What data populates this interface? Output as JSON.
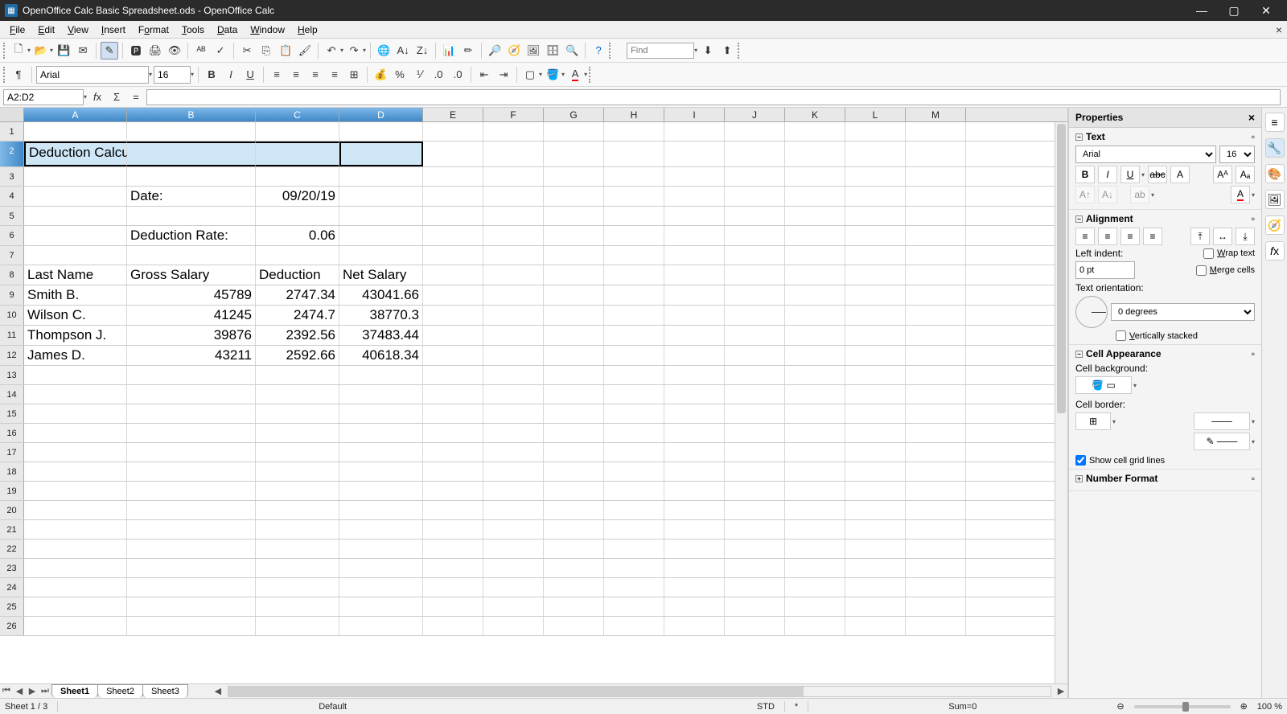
{
  "title": "OpenOffice Calc Basic Spreadsheet.ods - OpenOffice Calc",
  "menus": [
    "File",
    "Edit",
    "View",
    "Insert",
    "Format",
    "Tools",
    "Data",
    "Window",
    "Help"
  ],
  "find_placeholder": "Find",
  "font_name": "Arial",
  "font_size": "16",
  "cell_ref": "A2:D2",
  "columns": [
    "A",
    "B",
    "C",
    "D",
    "E",
    "F",
    "G",
    "H",
    "I",
    "J",
    "K",
    "L",
    "M"
  ],
  "cells": {
    "A2": "Deduction Calculations for Employees",
    "B4": "Date:",
    "C4": "09/20/19",
    "B6": "Deduction Rate:",
    "C6": "0.06",
    "A8": "Last Name",
    "B8": "Gross Salary",
    "C8": "Deduction",
    "D8": "Net Salary",
    "A9": "Smith B.",
    "B9": "45789",
    "C9": "2747.34",
    "D9": "43041.66",
    "A10": "Wilson C.",
    "B10": "41245",
    "C10": "2474.7",
    "D10": "38770.3",
    "A11": "Thompson J.",
    "B11": "39876",
    "C11": "2392.56",
    "D11": "37483.44",
    "A12": "James D.",
    "B12": "43211",
    "C12": "2592.66",
    "D12": "40618.34"
  },
  "sheets": [
    "Sheet1",
    "Sheet2",
    "Sheet3"
  ],
  "status": {
    "sheet": "Sheet 1 / 3",
    "style": "Default",
    "mode": "STD",
    "mod": "*",
    "sum": "Sum=0",
    "zoom": "100 %"
  },
  "sidebar": {
    "title": "Properties",
    "text_hdr": "Text",
    "font": "Arial",
    "size": "16",
    "align_hdr": "Alignment",
    "left_indent": "Left indent:",
    "indent_val": "0 pt",
    "wrap": "Wrap text",
    "merge": "Merge cells",
    "orient": "Text orientation:",
    "deg": "0 degrees",
    "vstack": "Vertically stacked",
    "cellapp_hdr": "Cell Appearance",
    "cellbg": "Cell background:",
    "cellborder": "Cell border:",
    "gridlines": "Show cell grid lines",
    "numfmt_hdr": "Number Format"
  }
}
